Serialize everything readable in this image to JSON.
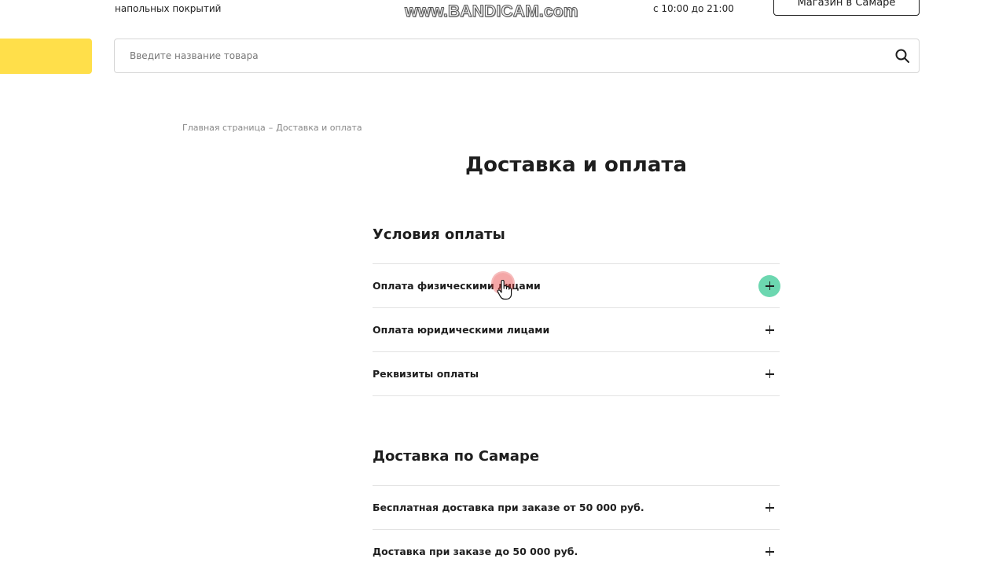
{
  "header": {
    "subtitle": "напольных покрытий",
    "watermark": "www.BANDICAM.com",
    "work_hours": "с 10:00 до 21:00",
    "store_button": "Магазин в Самаре"
  },
  "search": {
    "placeholder": "Введите название товара"
  },
  "breadcrumb": {
    "home": "Главная страница",
    "separator": "–",
    "current": "Доставка и оплата"
  },
  "page_title": "Доставка и оплата",
  "sections": [
    {
      "title": "Условия оплаты",
      "items": [
        {
          "label": "Оплата физическими лицами",
          "active": true
        },
        {
          "label": "Оплата юридическими лицами",
          "active": false
        },
        {
          "label": "Реквизиты оплаты",
          "active": false
        }
      ]
    },
    {
      "title": "Доставка по Самаре",
      "items": [
        {
          "label": "Бесплатная доставка при заказе от 50 000 руб.",
          "active": false
        },
        {
          "label": "Доставка при заказе до 50 000 руб.",
          "active": false
        }
      ]
    }
  ],
  "colors": {
    "accent_yellow": "#ffdf4a",
    "active_toggle": "#6cd7b0"
  },
  "icons": {
    "search": "search-icon",
    "toggle": "plus-icon",
    "cursor": "hand-pointer-icon"
  }
}
